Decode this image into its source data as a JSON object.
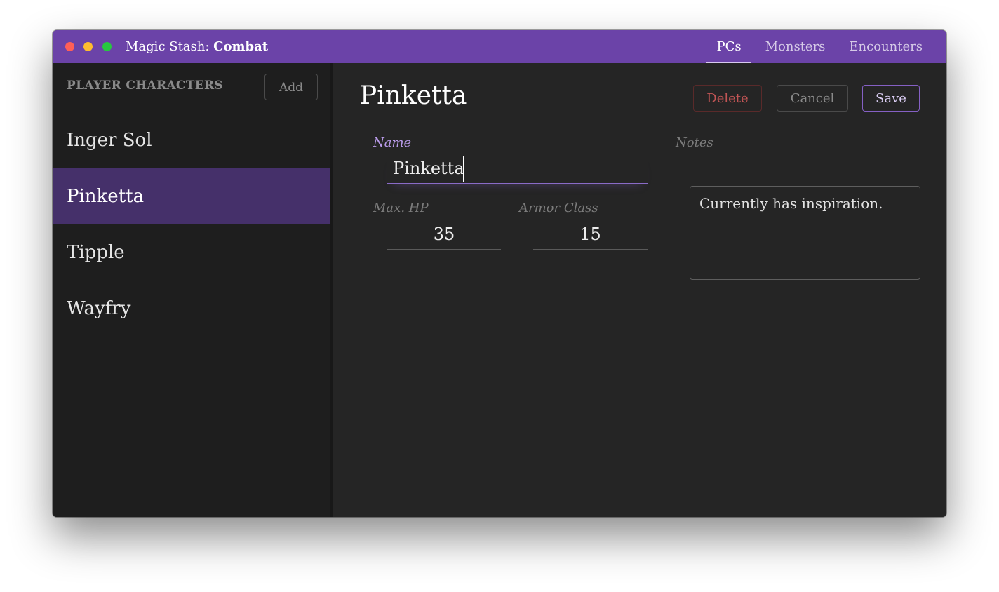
{
  "window": {
    "title_prefix": "Magic Stash: ",
    "title_bold": "Combat",
    "traffic_colors": [
      "#ff5f57",
      "#febc2e",
      "#28c840"
    ]
  },
  "nav": {
    "tabs": [
      {
        "label": "PCs",
        "active": true
      },
      {
        "label": "Monsters",
        "active": false
      },
      {
        "label": "Encounters",
        "active": false
      }
    ]
  },
  "sidebar": {
    "header": "PLAYER CHARACTERS",
    "add_label": "Add",
    "items": [
      {
        "label": "Inger Sol",
        "selected": false
      },
      {
        "label": "Pinketta",
        "selected": true
      },
      {
        "label": "Tipple",
        "selected": false
      },
      {
        "label": "Wayfry",
        "selected": false
      }
    ]
  },
  "detail": {
    "title": "Pinketta",
    "delete_label": "Delete",
    "cancel_label": "Cancel",
    "save_label": "Save",
    "name_label": "Name",
    "name_value": "Pinketta",
    "hp_label": "Max. HP",
    "hp_value": "35",
    "ac_label": "Armor Class",
    "ac_value": "15",
    "notes_label": "Notes",
    "notes_value": "Currently has inspiration."
  },
  "colors": {
    "titlebar": "#6b43a8",
    "selected_row": "#45306a",
    "accent": "#b89ae8",
    "danger": "#c25555"
  }
}
